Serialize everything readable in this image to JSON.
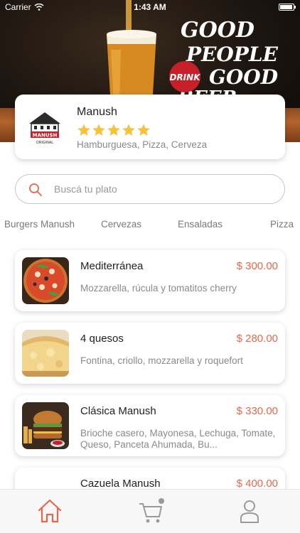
{
  "status_bar": {
    "carrier": "Carrier",
    "time": "1:43 AM"
  },
  "hero": {
    "poster_lines": [
      "GOOD",
      "PEOPLE",
      "GOOD",
      "BEER"
    ],
    "drink_badge": "DRINK"
  },
  "restaurant": {
    "name": "Manush",
    "rating": 5,
    "tags": "Hamburguesa, Pizza, Cerveza",
    "logo_text": "MANUSH",
    "logo_subtext": "ORIGINAL"
  },
  "search": {
    "placeholder": "Buscá tu plato"
  },
  "categories": [
    "Burgers Manush",
    "Cervezas",
    "Ensaladas",
    "Pizza"
  ],
  "products": [
    {
      "name": "Mediterránea",
      "price": "$ 300.00",
      "description": "Mozzarella, rúcula y tomatitos cherry"
    },
    {
      "name": "4 quesos",
      "price": "$ 280.00",
      "description": "Fontina, criollo, mozzarella y roquefort"
    },
    {
      "name": "Clásica Manush",
      "price": "$ 330.00",
      "description": "Brioche casero, Mayonesa, Lechuga, Tomate, Queso, Panceta Ahumada, Bu..."
    },
    {
      "name": "Cazuela Manush",
      "price": "$ 400.00",
      "description": ""
    }
  ],
  "colors": {
    "accent": "#e2694b",
    "star": "#f5c33b"
  },
  "tabbar": {
    "items": [
      "home-icon",
      "cart-icon",
      "user-icon"
    ],
    "active": "home-icon"
  }
}
